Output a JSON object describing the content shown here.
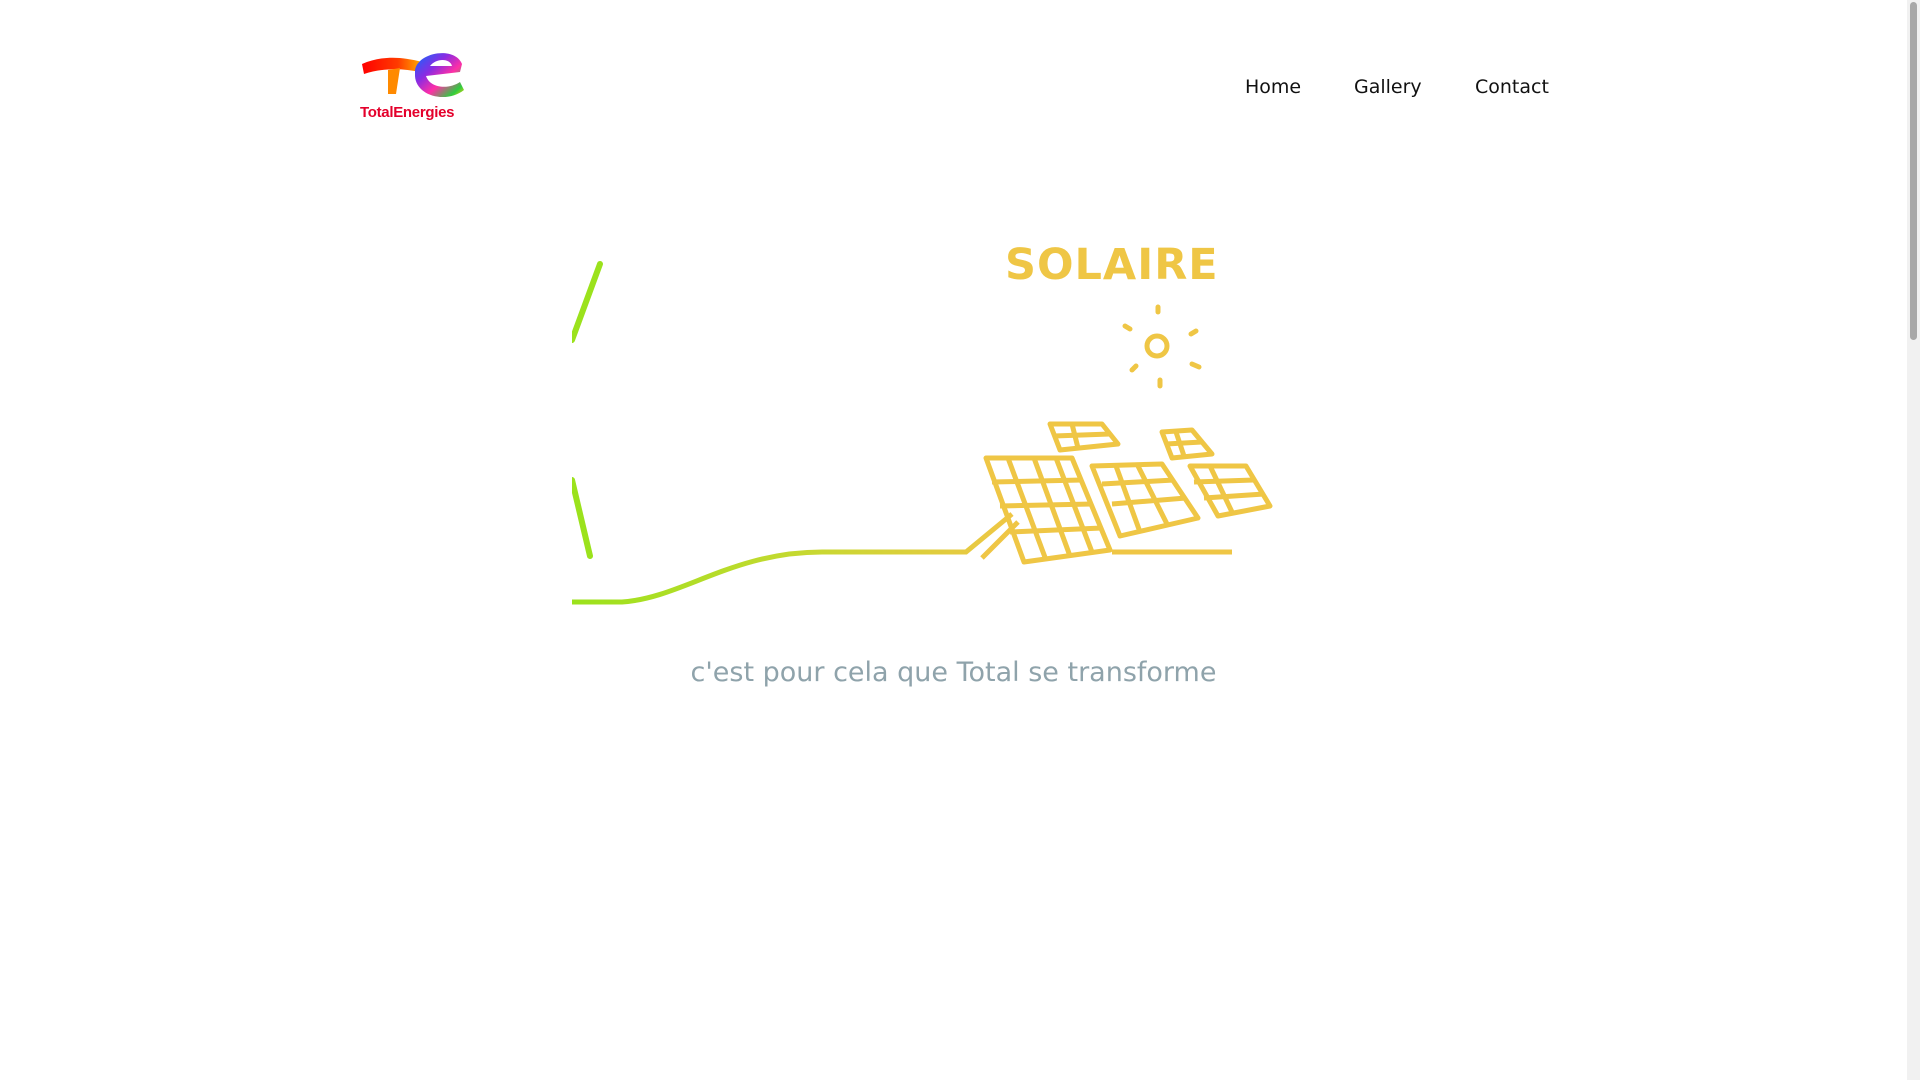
{
  "header": {
    "logo_text": "TotalEnergies",
    "nav": [
      {
        "label": "Home"
      },
      {
        "label": "Gallery"
      },
      {
        "label": "Contact"
      }
    ]
  },
  "hero": {
    "title": "SOLAIRE",
    "caption": "c'est pour cela que Total se transforme",
    "icons": [
      "sun-icon",
      "solar-panels-illustration"
    ]
  },
  "colors": {
    "brand_red": "#e4002b",
    "solar_yellow": "#efc645",
    "line_green": "#9be21c",
    "caption_gray": "#8fa3ab"
  }
}
